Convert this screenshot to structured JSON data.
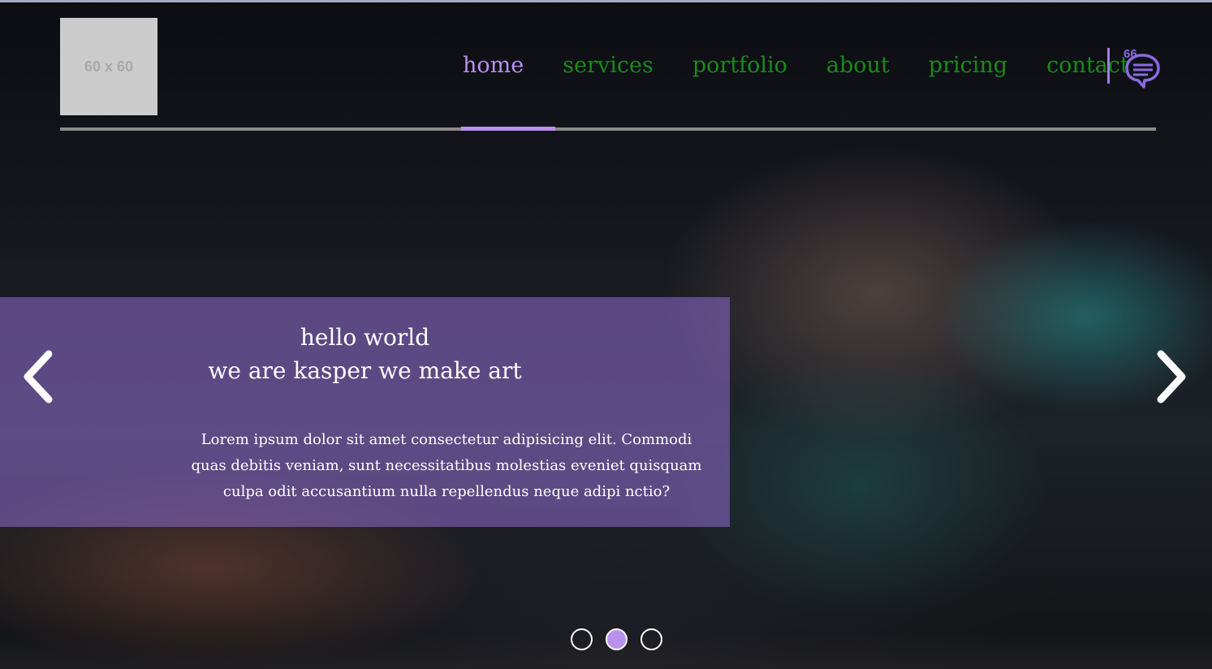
{
  "logo": {
    "text": "60 x 60"
  },
  "nav": {
    "items": [
      {
        "label": "home",
        "active": true
      },
      {
        "label": "services",
        "active": false
      },
      {
        "label": "portfolio",
        "active": false
      },
      {
        "label": "about",
        "active": false
      },
      {
        "label": "pricing",
        "active": false
      },
      {
        "label": "contact",
        "active": false
      }
    ],
    "chat_icon": "chat-bubble-icon",
    "chat_badge": "66"
  },
  "slider": {
    "heading_line1": "hello world",
    "heading_line2": "we are kasper we make art",
    "body": "Lorem ipsum dolor sit amet consectetur adipisicing elit. Commodi quas debitis veniam, sunt necessitatibus molestias eveniet quisquam culpa odit accusantium nulla repellendus neque adipi nctio?",
    "prev_icon": "chevron-left-icon",
    "next_icon": "chevron-right-icon",
    "dots": [
      {
        "active": false
      },
      {
        "active": true
      },
      {
        "active": false
      }
    ]
  },
  "colors": {
    "accent": "#b991ed",
    "nav_link": "#1a8a1a",
    "caption_bg": "#8464be",
    "rail": "#8b8b8b"
  }
}
